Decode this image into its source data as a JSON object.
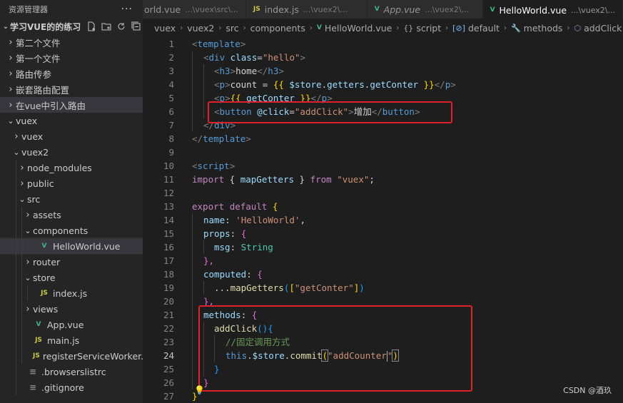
{
  "sidebar": {
    "title": "资源管理器",
    "more": "···",
    "project": "学习VUE的的练习",
    "items": [
      {
        "label": "第二个文件",
        "depth": 1,
        "expanded": false
      },
      {
        "label": "第一个文件",
        "depth": 1,
        "expanded": false
      },
      {
        "label": "路由传参",
        "depth": 1,
        "expanded": false
      },
      {
        "label": "嵌套路由配置",
        "depth": 1,
        "expanded": false
      },
      {
        "label": "在vue中引入路由",
        "depth": 1,
        "expanded": false
      },
      {
        "label": "vuex",
        "depth": 1,
        "expanded": true
      },
      {
        "label": "vuex",
        "depth": 2,
        "expanded": false
      },
      {
        "label": "vuex2",
        "depth": 2,
        "expanded": true
      },
      {
        "label": "node_modules",
        "depth": 3,
        "expanded": false
      },
      {
        "label": "public",
        "depth": 3,
        "expanded": false
      },
      {
        "label": "src",
        "depth": 3,
        "expanded": true
      },
      {
        "label": "assets",
        "depth": 4,
        "expanded": false
      },
      {
        "label": "components",
        "depth": 4,
        "expanded": true
      },
      {
        "label": "HelloWorld.vue",
        "depth": 5,
        "file": "vue"
      },
      {
        "label": "router",
        "depth": 4,
        "expanded": false
      },
      {
        "label": "store",
        "depth": 4,
        "expanded": true
      },
      {
        "label": "index.js",
        "depth": 5,
        "file": "js"
      },
      {
        "label": "views",
        "depth": 4,
        "expanded": false
      },
      {
        "label": "App.vue",
        "depth": 4,
        "file": "vue"
      },
      {
        "label": "main.js",
        "depth": 4,
        "file": "js"
      },
      {
        "label": "registerServiceWorker.js",
        "depth": 4,
        "file": "js"
      },
      {
        "label": ".browserslistrc",
        "depth": 3,
        "file": "cfg"
      },
      {
        "label": ".gitignore",
        "depth": 3,
        "file": "cfg"
      }
    ]
  },
  "tabs": [
    {
      "label": "orld.vue",
      "desc": "...\\vuex\\src\\...",
      "icon": ""
    },
    {
      "label": "index.js",
      "desc": "...\\vuex2\\...",
      "icon": "JS"
    },
    {
      "label": "App.vue",
      "desc": "...\\vuex2\\...",
      "icon": "V"
    },
    {
      "label": "HelloWorld.vue",
      "desc": "...\\vuex2\\...",
      "icon": "V"
    }
  ],
  "breadcrumb": [
    "vuex",
    "vuex2",
    "src",
    "components",
    "HelloWorld.vue",
    "script",
    "default",
    "methods",
    "addClick"
  ],
  "code_lines": [
    "1",
    "2",
    "3",
    "4",
    "5",
    "6",
    "7",
    "8",
    "9",
    "10",
    "11",
    "12",
    "13",
    "14",
    "15",
    "16",
    "17",
    "18",
    "19",
    "20",
    "21",
    "22",
    "23",
    "24",
    "25",
    "26",
    "27"
  ],
  "code": {
    "l1": [
      "<",
      "template",
      ">"
    ],
    "l2": [
      "<",
      "div",
      "class",
      "=",
      "\"hello\"",
      ">"
    ],
    "l3": [
      "<",
      "h3",
      ">",
      "home",
      "</",
      "h3",
      ">"
    ],
    "l4": [
      "<",
      "p",
      ">",
      "count = ",
      "{{",
      " $store",
      ".",
      "getters",
      ".",
      "getConter",
      " }}",
      "</",
      "p",
      ">"
    ],
    "l5": [
      "<",
      "p",
      ">",
      "{{",
      " getConter ",
      "}}",
      "</",
      "p",
      ">"
    ],
    "l6": [
      "<",
      "button",
      "@click",
      "=",
      "\"addClick\"",
      ">",
      "增加",
      "</",
      "button",
      ">"
    ],
    "l7": [
      "</",
      "div",
      ">"
    ],
    "l8": [
      "</",
      "template",
      ">"
    ],
    "l10": [
      "<",
      "script",
      ">"
    ],
    "l11": [
      "import",
      " { ",
      "mapGetters",
      " } ",
      "from",
      " \"vuex\"",
      ";"
    ],
    "l13": [
      "export",
      " ",
      "default",
      " {"
    ],
    "l14": [
      "name",
      ": ",
      "'HelloWorld'",
      ","
    ],
    "l15": [
      "props",
      ": ",
      "{"
    ],
    "l16": [
      "msg",
      ": ",
      "String"
    ],
    "l17": [
      "},"
    ],
    "l18": [
      "computed",
      ": ",
      "{"
    ],
    "l19": [
      "...",
      "mapGetters",
      "(",
      "[",
      "\"getConter\"",
      "]",
      ")"
    ],
    "l20": [
      "},"
    ],
    "l21": [
      "methods",
      ": ",
      "{"
    ],
    "l22": [
      "addClick",
      "(",
      ")",
      "{"
    ],
    "l23": [
      "//固定调用方式"
    ],
    "l24": [
      "this",
      ".",
      "$store",
      ".",
      "commit",
      "(",
      "\"addCounter",
      "\"",
      ")"
    ],
    "l25": [
      "}"
    ],
    "l26": [
      "}"
    ],
    "l27": [
      "}"
    ]
  },
  "watermark": "CSDN @酒玖",
  "colors": {
    "highlight_box": "#e0202b",
    "vue_icon": "#41b883",
    "js_icon": "#cbcb41"
  }
}
